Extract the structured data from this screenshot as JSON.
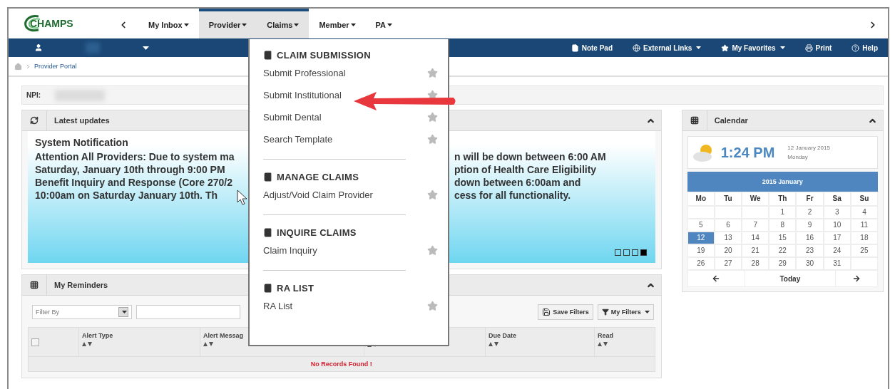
{
  "logo": {
    "text": "CHAMPS"
  },
  "nav": {
    "tabs": [
      {
        "label": "My Inbox",
        "selected": false
      },
      {
        "label": "Provider",
        "selected": true
      },
      {
        "label": "Claims",
        "selected": true
      },
      {
        "label": "Member",
        "selected": false
      },
      {
        "label": "PA",
        "selected": false
      }
    ]
  },
  "toolbar": {
    "links": [
      {
        "kind": "notepad",
        "label": "Note Pad",
        "dropdown": false
      },
      {
        "kind": "globe",
        "label": "External Links",
        "dropdown": true
      },
      {
        "kind": "star",
        "label": "My Favorites",
        "dropdown": true
      },
      {
        "kind": "print",
        "label": "Print",
        "dropdown": false
      },
      {
        "kind": "help",
        "label": "Help",
        "dropdown": false
      }
    ]
  },
  "breadcrumb": {
    "current": "Provider Portal"
  },
  "npi": {
    "label": "NPI:"
  },
  "latest_updates": {
    "title": "Latest updates",
    "heading": "System Notification",
    "lines": [
      {
        "left": "Attention All Providers: Due to system ma",
        "right": "n will be down between 6:00 AM"
      },
      {
        "left": "Saturday, January 10th through 9:00 PM",
        "right": "ption of Health Care Eligibility"
      },
      {
        "left": "Benefit Inquiry and Response (Core 270/2",
        "right": "down between 6:00am and"
      },
      {
        "left": "10:00am on Saturday January 10th. Th",
        "right": "cess for all functionality."
      }
    ],
    "slides": [
      {
        "selected": false
      },
      {
        "selected": false
      },
      {
        "selected": false
      },
      {
        "selected": true
      }
    ]
  },
  "reminders": {
    "title": "My Reminders",
    "filter_placeholder": "Filter By",
    "select_all": {
      "checked": false
    },
    "buttons": [
      {
        "kind": "save",
        "label": "Save Filters"
      },
      {
        "kind": "filters",
        "label": "My Filters"
      }
    ],
    "columns": [
      {
        "label": "Alert Type"
      },
      {
        "label": "Alert Messag"
      },
      {},
      {
        "label": "Due Date"
      },
      {
        "label": "Read"
      }
    ],
    "empty_message": "No Records Found !"
  },
  "calendar": {
    "title": "Calendar",
    "time": "1:24 PM",
    "date": "12 January 2015",
    "weekday": "Monday",
    "month": "2015 January",
    "day_names": [
      "Mo",
      "Tu",
      "We",
      "Th",
      "Fr",
      "Sa",
      "Su"
    ],
    "weeks": [
      [
        {
          "d": "1",
          "selected": false
        },
        {
          "d": "2",
          "selected": false
        },
        {
          "d": "3",
          "selected": false
        },
        {
          "d": "4",
          "selected": false
        }
      ],
      [
        {
          "d": "5",
          "selected": false
        },
        {
          "d": "6",
          "selected": false
        },
        {
          "d": "7",
          "selected": false
        },
        {
          "d": "8",
          "selected": false
        },
        {
          "d": "9",
          "selected": false
        },
        {
          "d": "10",
          "selected": false
        },
        {
          "d": "11",
          "selected": false
        }
      ],
      [
        {
          "d": "12",
          "selected": true
        },
        {
          "d": "13",
          "selected": false
        },
        {
          "d": "14",
          "selected": false
        },
        {
          "d": "15",
          "selected": false
        },
        {
          "d": "16",
          "selected": false
        },
        {
          "d": "17",
          "selected": false
        },
        {
          "d": "18",
          "selected": false
        }
      ],
      [
        {
          "d": "19",
          "selected": false
        },
        {
          "d": "20",
          "selected": false
        },
        {
          "d": "21",
          "selected": false
        },
        {
          "d": "22",
          "selected": false
        },
        {
          "d": "23",
          "selected": false
        },
        {
          "d": "24",
          "selected": false
        },
        {
          "d": "25",
          "selected": false
        }
      ],
      [
        {
          "d": "26",
          "selected": false
        },
        {
          "d": "27",
          "selected": false
        },
        {
          "d": "28",
          "selected": false
        },
        {
          "d": "29",
          "selected": false
        },
        {
          "d": "30",
          "selected": false
        },
        {
          "d": "31",
          "selected": false
        }
      ]
    ],
    "today": "Today"
  },
  "claims_menu": {
    "sections": [
      {
        "title": "CLAIM SUBMISSION",
        "items": [
          "Submit Professional",
          "Submit Institutional",
          "Submit Dental",
          "Search Template"
        ]
      },
      {
        "title": "MANAGE CLAIMS",
        "items": [
          "Adjust/Void Claim Provider"
        ]
      },
      {
        "title": "INQUIRE CLAIMS",
        "items": [
          "Claim Inquiry"
        ]
      },
      {
        "title": "RA LIST",
        "items": [
          "RA List"
        ]
      }
    ]
  }
}
